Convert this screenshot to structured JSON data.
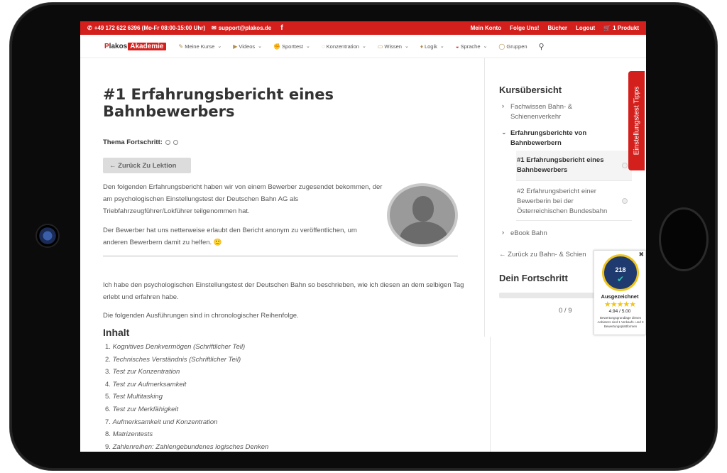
{
  "topbar": {
    "phone": "+49 172 622 6396 (Mo-Fr 08:00-15:00 Uhr)",
    "email": "support@plakos.de",
    "facebook": "f",
    "links": [
      "Mein Konto",
      "Folge Uns!",
      "Bücher",
      "Logout"
    ],
    "cart": "1 Produkt"
  },
  "logo": {
    "p": "P",
    "plakos": "lakos",
    "akademie": "Akademie"
  },
  "nav": {
    "items": [
      {
        "label": "Meine Kurse",
        "dropdown": true
      },
      {
        "label": "Videos",
        "dropdown": true
      },
      {
        "label": "Sporttest",
        "dropdown": true
      },
      {
        "label": "Konzentration",
        "dropdown": true
      },
      {
        "label": "Wissen",
        "dropdown": true
      },
      {
        "label": "Logik",
        "dropdown": true
      },
      {
        "label": "Sprache",
        "dropdown": true
      },
      {
        "label": "Gruppen",
        "dropdown": false
      }
    ]
  },
  "main": {
    "title": "#1 Erfahrungsbericht eines Bahnbewerbers",
    "progress_label": "Thema Fortschritt:",
    "back_button": "← Zurück Zu Lektion",
    "para1": "Den folgenden Erfahrungsbericht haben wir von einem Bewerber zugesendet bekommen, der am psychologischen Einstellungstest der Deutschen Bahn AG als Triebfahrzeugführer/Lokführer teilgenommen hat.",
    "para2": "Der Bewerber hat uns netterweise erlaubt den Bericht anonym zu veröffentlichen, um anderen Bewerbern damit zu helfen. 🙂",
    "para3": "Ich habe den psychologischen Einstellungstest der Deutschen Bahn so beschrieben, wie ich diesen an dem selbigen Tag erlebt und erfahren habe.",
    "para4": "Die folgenden Ausführungen sind in chronologischer Reihenfolge.",
    "inhalt": "Inhalt",
    "toc": [
      {
        "num": "1.",
        "text": "Kognitives Denkvermögen (Schriftlicher Teil)"
      },
      {
        "num": "2.",
        "text": "Technisches Verständnis (Schriftlicher Teil)"
      },
      {
        "num": "3.",
        "text": "Test zur Konzentration"
      },
      {
        "num": "4.",
        "text": "Test zur Aufmerksamkeit"
      },
      {
        "num": "5.",
        "text": "Test Multitasking"
      },
      {
        "num": "6.",
        "text": "Test zur Merkfähigkeit"
      },
      {
        "num": "7.",
        "text": "Aufmerksamkeit und Konzentration"
      },
      {
        "num": "8.",
        "text": "Matrizentests"
      },
      {
        "num": "9.",
        "text": "Zahlenreihen: Zahlengebundenes logisches Denken"
      }
    ]
  },
  "sidebar": {
    "title": "Kursübersicht",
    "item1": "Fachwissen Bahn- & Schienenverkehr",
    "item2": "Erfahrungsberichte von Bahnbewerbern",
    "sub1": "#1 Erfahrungsbericht eines Bahnbewerbers",
    "sub2": "#2 Erfahrungsbericht einer Bewerberin bei der Österreichischen Bundesbahn",
    "item3": "eBook Bahn",
    "back": "← Zurück zu Bahn- & Schien",
    "fortschritt": "Dein Fortschritt",
    "progress_value": 0,
    "count": "0 / 9"
  },
  "tips_tab": "Einstellungstest Tipps",
  "trust": {
    "count": "218",
    "label": "Ausgezeichnet",
    "stars": "★★★★★",
    "score": "4.94 / 5.00",
    "small": "Bewertungsgrundlage dieses Anbieters sind 1 Verkaufs- und 3 Bewertungsplattformen",
    "close": "✖"
  },
  "colors": {
    "brand_red": "#d3201d",
    "text_dark": "#333333",
    "text_body": "#555555"
  }
}
